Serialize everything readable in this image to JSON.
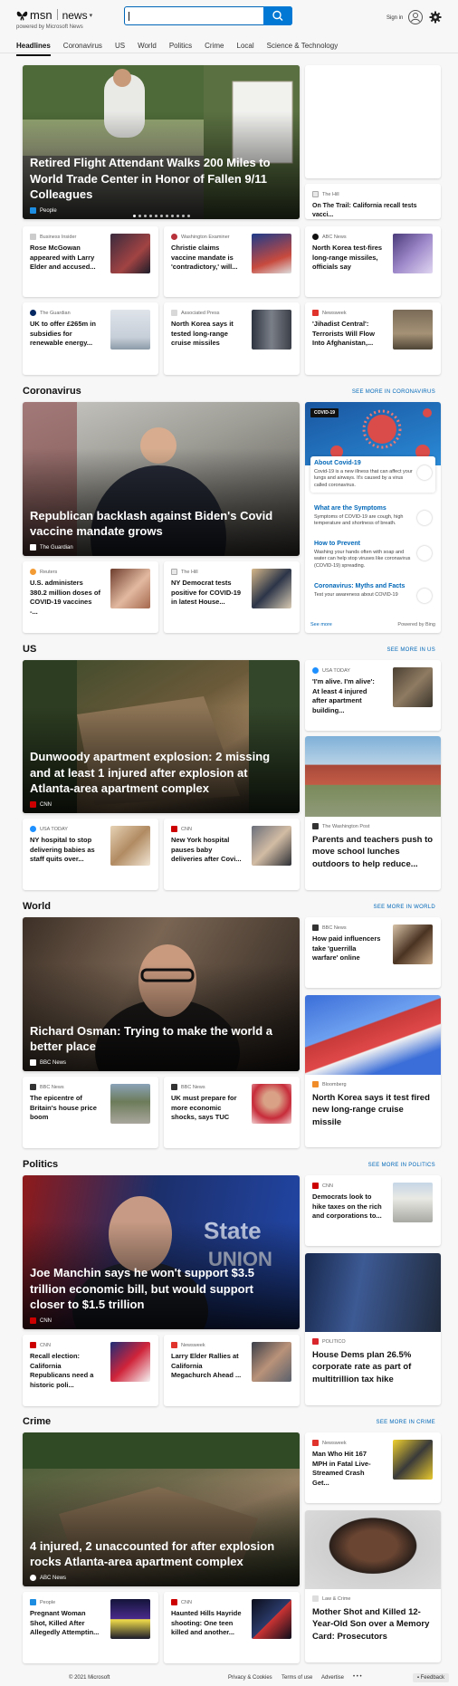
{
  "header": {
    "brand": "msn",
    "section": "news",
    "powered_by": "powered by Microsoft News",
    "search_placeholder": "",
    "sign_in": "Sign in"
  },
  "nav": [
    "Headlines",
    "Coronavirus",
    "US",
    "World",
    "Politics",
    "Crime",
    "Local",
    "Science & Technology"
  ],
  "top": {
    "hero": {
      "title": "Retired Flight Attendant Walks 200 Miles to World Trade Center in Honor of Fallen 9/11 Colleagues",
      "source": "People"
    },
    "side": {
      "source": "The Hill",
      "title": "On The Trail: California recall tests vacci..."
    },
    "cards": [
      {
        "source": "Business Insider",
        "title": "Rose McGowan appeared with Larry Elder and accused..."
      },
      {
        "source": "Washington Examiner",
        "title": "Christie claims vaccine mandate is 'contradictory,' will..."
      },
      {
        "source": "ABC News",
        "title": "North Korea test-fires long-range missiles, officials say"
      },
      {
        "source": "The Guardian",
        "title": "UK to offer £265m in subsidies for renewable energy..."
      },
      {
        "source": "Associated Press",
        "title": "North Korea says it tested long-range cruise missiles"
      },
      {
        "source": "Newsweek",
        "title": "'Jihadist Central': Terrorists Will Flow Into Afghanistan,..."
      }
    ]
  },
  "coronavirus": {
    "title": "Coronavirus",
    "more": "SEE MORE IN CORONAVIRUS",
    "hero": {
      "title": "Republican backlash against Biden's Covid vaccine mandate grows",
      "source": "The Guardian"
    },
    "cards": [
      {
        "source": "Reuters",
        "title": "U.S. administers 380.2 million doses of COVID-19 vaccines -..."
      },
      {
        "source": "The Hill",
        "title": "NY Democrat tests positive for COVID-19 in latest House..."
      }
    ],
    "panel": {
      "badge": "COVID-19",
      "items": [
        {
          "title": "About Covid-19",
          "desc": "Covid-19 is a new illness that can affect your lungs and airways. It's caused by a virus called coronavirus."
        },
        {
          "title": "What are the Symptoms",
          "desc": "Symptoms of COVID-19 are cough, high temperature and shortness of breath."
        },
        {
          "title": "How to Prevent",
          "desc": "Washing your hands often with soap and water can help stop viruses like coronavirus (COVID-19) spreading."
        },
        {
          "title": "Coronavirus: Myths and Facts",
          "desc": "Test your awareness about COVID-19"
        }
      ],
      "see_more": "See more",
      "powered": "Powered by Bing"
    }
  },
  "us": {
    "title": "US",
    "more": "SEE MORE IN US",
    "hero": {
      "title": "Dunwoody apartment explosion: 2 missing and at least 1 injured after explosion at Atlanta-area apartment complex",
      "source": "CNN"
    },
    "side_card": {
      "source": "USA TODAY",
      "title": "'I'm alive. I'm alive': At least 4 injured after apartment building..."
    },
    "tall": {
      "source": "The Washington Post",
      "title": "Parents and teachers push to move school lunches outdoors to help reduce..."
    },
    "cards": [
      {
        "source": "USA TODAY",
        "title": "NY hospital to stop delivering babies as staff quits over..."
      },
      {
        "source": "CNN",
        "title": "New York hospital pauses baby deliveries after Covi..."
      }
    ]
  },
  "world": {
    "title": "World",
    "more": "SEE MORE IN WORLD",
    "hero": {
      "title": "Richard Osman: Trying to make the world a better place",
      "source": "BBC News"
    },
    "side_card": {
      "source": "BBC News",
      "title": "How paid influencers take 'guerrilla warfare' online"
    },
    "tall": {
      "source": "Bloomberg",
      "title": "North Korea says it test fired new long-range cruise missile"
    },
    "cards": [
      {
        "source": "BBC News",
        "title": "The epicentre of Britain's house price boom"
      },
      {
        "source": "BBC News",
        "title": "UK must prepare for more economic shocks, says TUC"
      }
    ]
  },
  "politics": {
    "title": "Politics",
    "more": "SEE MORE IN POLITICS",
    "hero": {
      "title": "Joe Manchin says he won't support $3.5 trillion economic bill, but would support closer to $1.5 trillion",
      "source": "CNN"
    },
    "side_card": {
      "source": "CNN",
      "title": "Democrats look to hike taxes on the rich and corporations to..."
    },
    "tall": {
      "source": "POLITICO",
      "title": "House Dems plan 26.5% corporate rate as part of multitrillion tax hike"
    },
    "cards": [
      {
        "source": "CNN",
        "title": "Recall election: California Republicans need a historic poli..."
      },
      {
        "source": "Newsweek",
        "title": "Larry Elder Rallies at California Megachurch Ahead ..."
      }
    ]
  },
  "crime": {
    "title": "Crime",
    "more": "SEE MORE IN CRIME",
    "hero": {
      "title": "4 injured, 2 unaccounted for after explosion rocks Atlanta-area apartment complex",
      "source": "ABC News"
    },
    "side_card": {
      "source": "Newsweek",
      "title": "Man Who Hit 167 MPH in Fatal Live-Streamed Crash Get..."
    },
    "tall": {
      "source": "Law & Crime",
      "title": "Mother Shot and Killed 12-Year-Old Son over a Memory Card: Prosecutors"
    },
    "cards": [
      {
        "source": "People",
        "title": "Pregnant Woman Shot, Killed After Allegedly Attemptin..."
      },
      {
        "source": "CNN",
        "title": "Haunted Hills Hayride shooting: One teen killed and another..."
      }
    ]
  },
  "footer": {
    "copyright": "© 2021 Microsoft",
    "privacy": "Privacy & Cookies",
    "terms": "Terms of use",
    "advertise": "Advertise",
    "more": "• • •",
    "feedback": "Feedback"
  }
}
